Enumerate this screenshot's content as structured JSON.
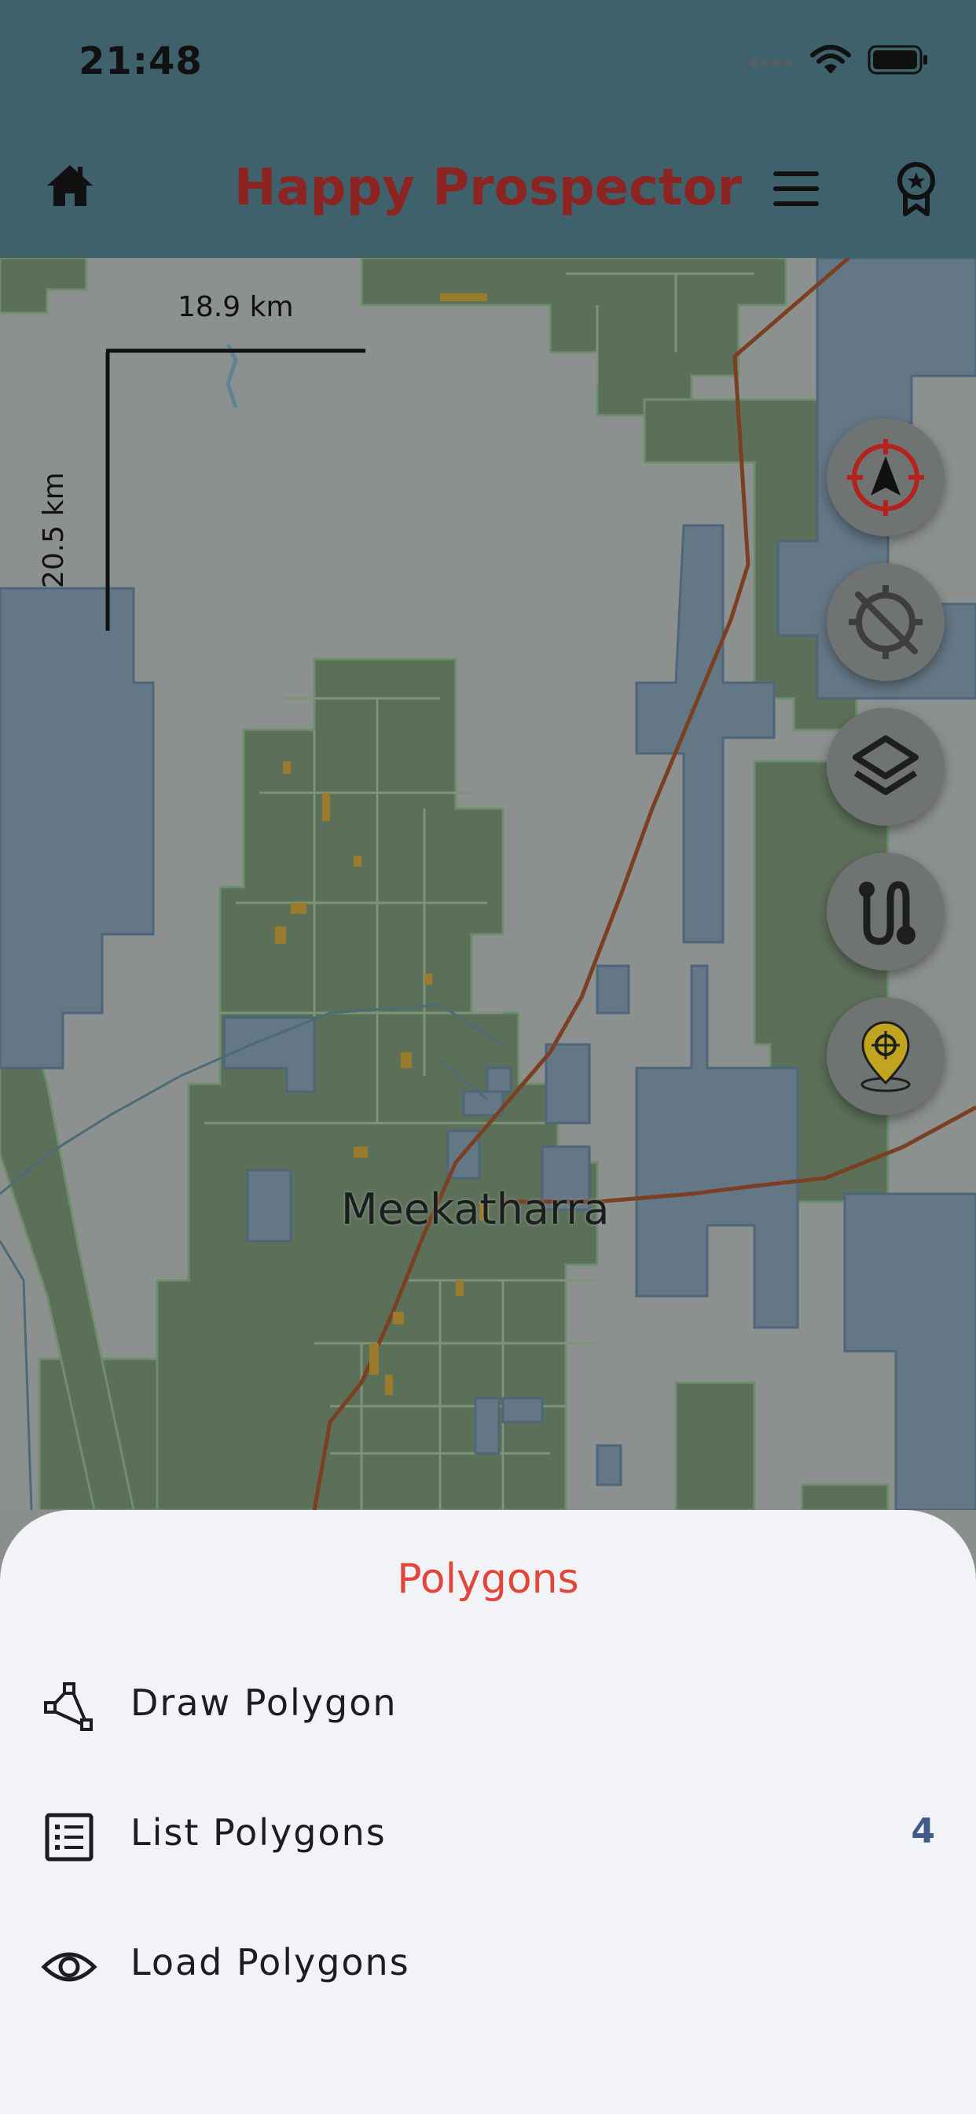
{
  "status_bar": {
    "time": "21:48"
  },
  "app_bar": {
    "title": "Happy Prospector"
  },
  "map": {
    "scale_horizontal": "18.9 km",
    "scale_vertical": "20.5 km",
    "town": "Meekatharra"
  },
  "sheet": {
    "title": "Polygons",
    "items": [
      {
        "label": "Draw Polygon",
        "icon": "polygon-draw-icon"
      },
      {
        "label": "List Polygons",
        "icon": "list-icon",
        "count": "4"
      },
      {
        "label": "Load Polygons",
        "icon": "eye-icon"
      }
    ]
  },
  "colors": {
    "header": "#3f616c",
    "title": "#8c2522",
    "sheet_title": "#e2463b",
    "count": "#425a88"
  }
}
